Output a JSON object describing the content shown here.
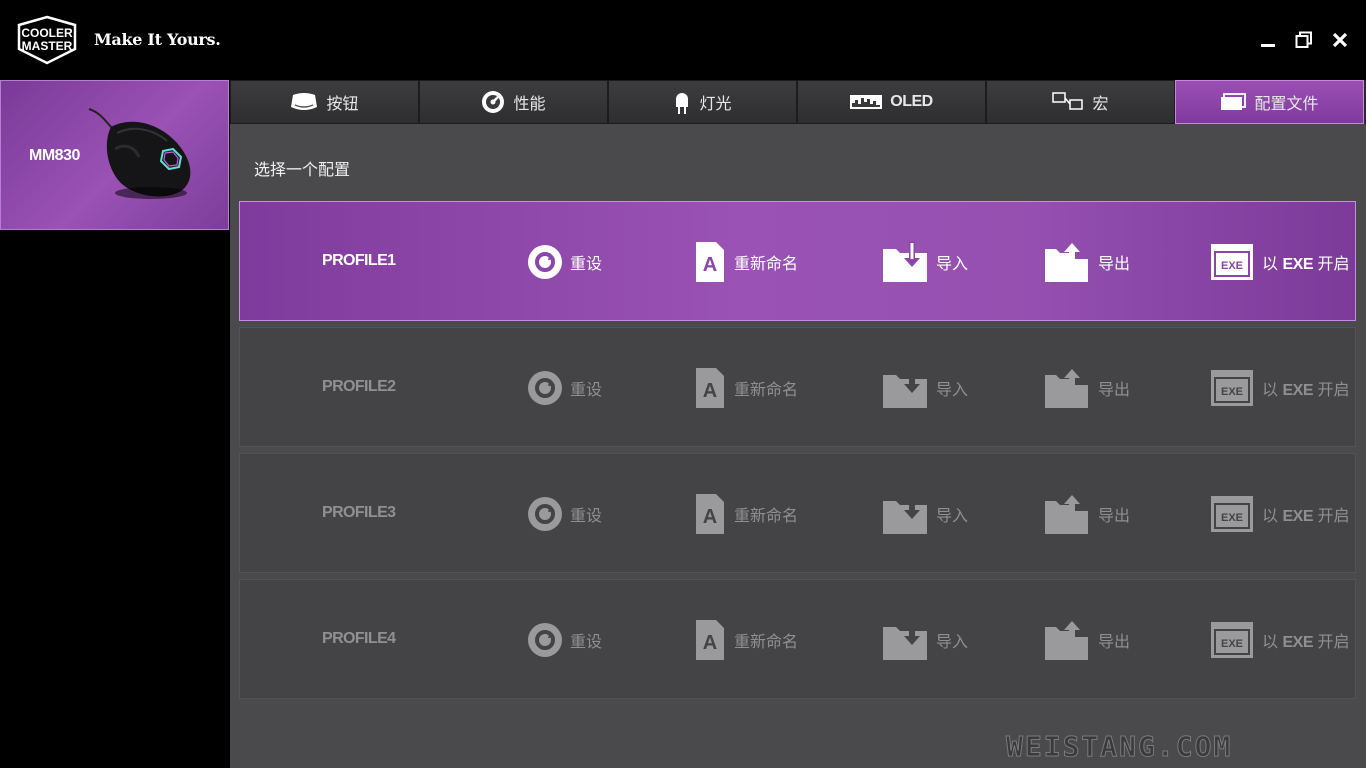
{
  "header": {
    "logo_lines": [
      "COOLER",
      "MASTER"
    ],
    "tagline": "Make It Yours.",
    "controls": {
      "minimize": "minimize-icon",
      "maximize": "restore-icon",
      "close": "close-icon"
    }
  },
  "device": {
    "name": "MM830"
  },
  "tabs": [
    {
      "label": "按钮",
      "icon": "button-icon"
    },
    {
      "label": "性能",
      "icon": "performance-icon"
    },
    {
      "label": "灯光",
      "icon": "light-icon"
    },
    {
      "label": "OLED",
      "icon": "oled-icon"
    },
    {
      "label": "宏",
      "icon": "macro-icon"
    },
    {
      "label": "配置文件",
      "icon": "profile-icon",
      "active": true
    }
  ],
  "select_label": "选择一个配置",
  "actions": {
    "reset": "重设",
    "rename": "重新命名",
    "import": "导入",
    "export": "导出",
    "exe_prefix": "以",
    "exe_strong": "EXE",
    "exe_suffix": "开启",
    "exe_icon_text": "EXE",
    "rename_icon_text": "A"
  },
  "profiles": [
    {
      "name": "PROFILE1",
      "active": true
    },
    {
      "name": "PROFILE2",
      "active": false
    },
    {
      "name": "PROFILE3",
      "active": false
    },
    {
      "name": "PROFILE4",
      "active": false
    }
  ],
  "watermark": "WEISTANG.COM",
  "colors": {
    "accent": "#9a52b4",
    "panel": "#4a4a4d",
    "row": "#444447"
  }
}
